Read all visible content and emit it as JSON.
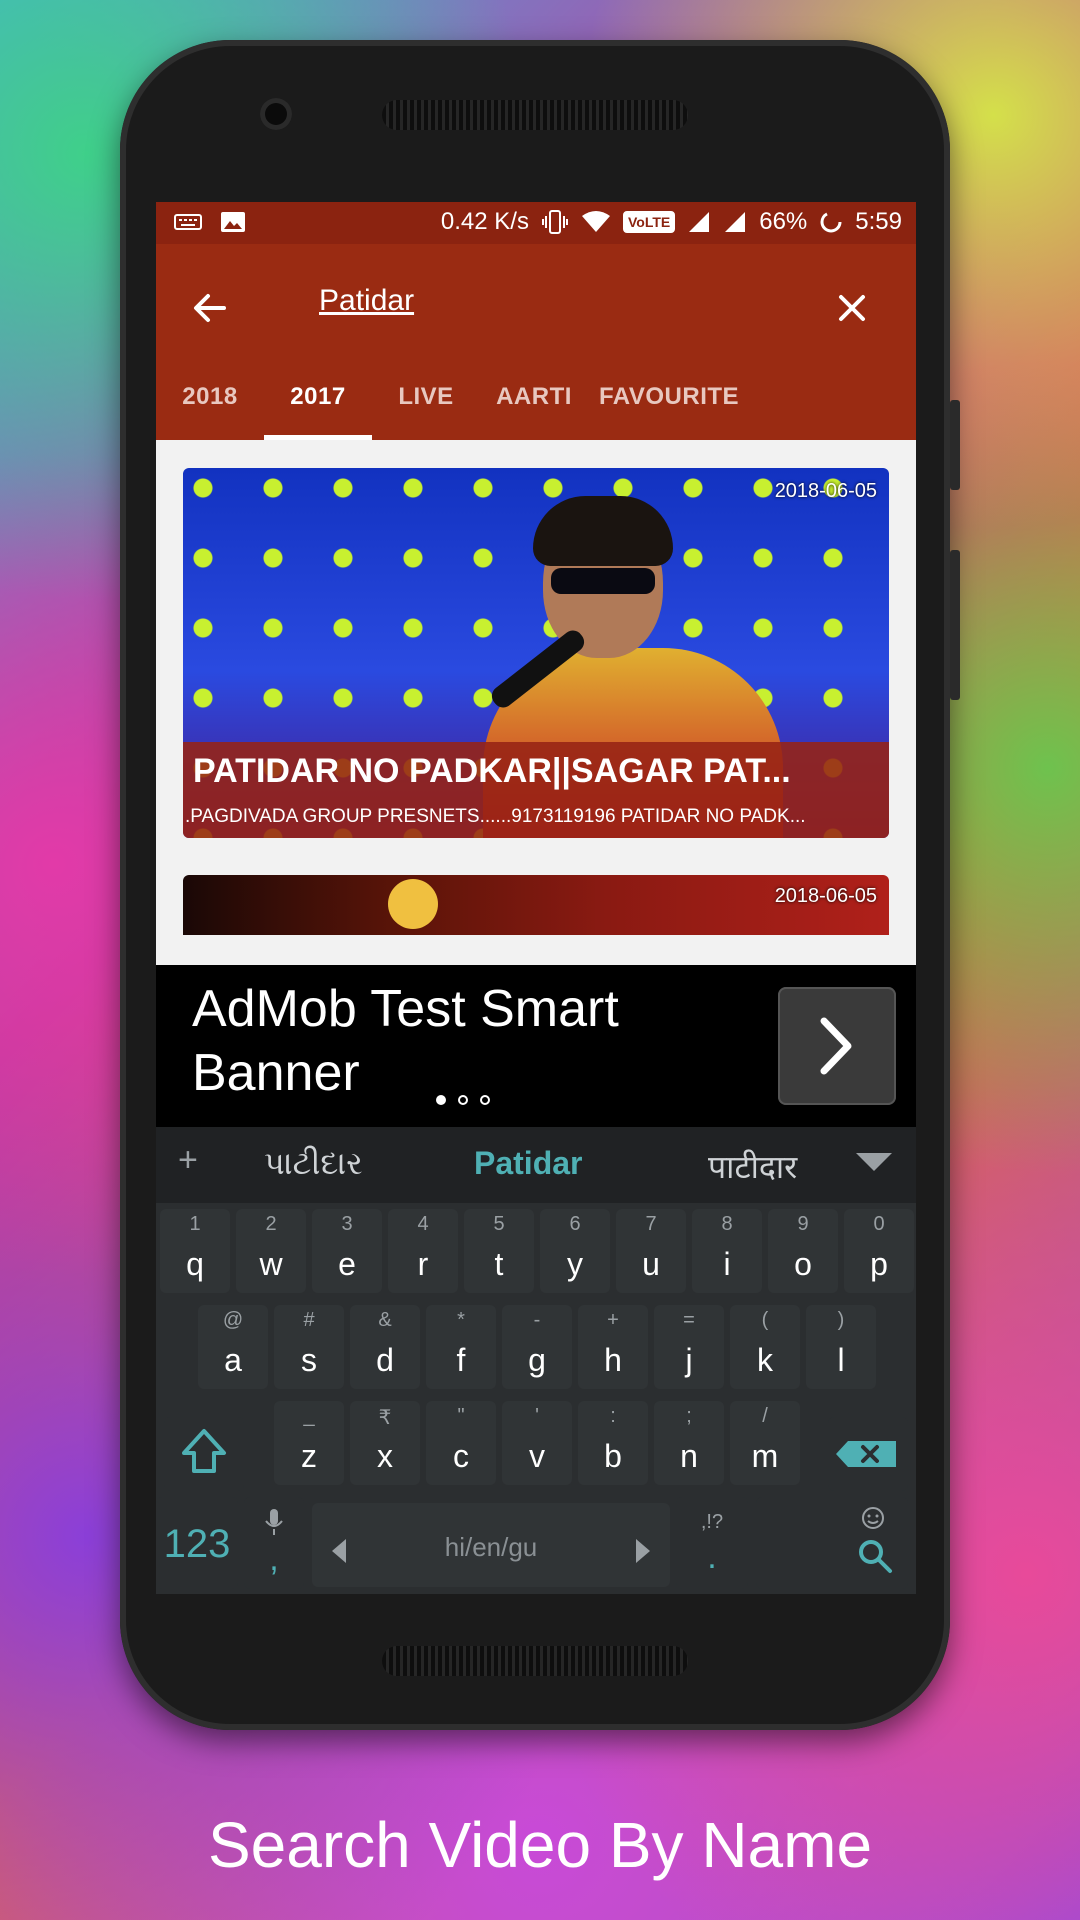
{
  "status_bar": {
    "speed": "0.42 K/s",
    "lte": "VoLTE",
    "battery": "66%",
    "time": "5:59"
  },
  "search": {
    "query": "Patidar"
  },
  "tabs": [
    {
      "label": "2018",
      "active": false
    },
    {
      "label": "2017",
      "active": true
    },
    {
      "label": "LIVE",
      "active": false
    },
    {
      "label": "AARTI",
      "active": false
    },
    {
      "label": "FAVOURITE",
      "active": false
    }
  ],
  "videos": [
    {
      "date": "2018-06-05",
      "title": "PATIDAR NO PADKAR||SAGAR PAT...",
      "description": ".PAGDIVADA GROUP PRESNETS......9173119196 PATIDAR NO PADK..."
    },
    {
      "date": "2018-06-05"
    }
  ],
  "ad": {
    "text": "AdMob Test Smart Banner",
    "arrow_icon": "chevron-right-icon"
  },
  "keyboard": {
    "suggestions": [
      "પાટીદાર",
      "Patidar",
      "पाटीदार"
    ],
    "plus": "+",
    "row1": [
      {
        "hint": "1",
        "key": "q"
      },
      {
        "hint": "2",
        "key": "w"
      },
      {
        "hint": "3",
        "key": "e"
      },
      {
        "hint": "4",
        "key": "r"
      },
      {
        "hint": "5",
        "key": "t"
      },
      {
        "hint": "6",
        "key": "y"
      },
      {
        "hint": "7",
        "key": "u"
      },
      {
        "hint": "8",
        "key": "i"
      },
      {
        "hint": "9",
        "key": "o"
      },
      {
        "hint": "0",
        "key": "p"
      }
    ],
    "row2": [
      {
        "hint": "@",
        "key": "a"
      },
      {
        "hint": "#",
        "key": "s"
      },
      {
        "hint": "&",
        "key": "d"
      },
      {
        "hint": "*",
        "key": "f"
      },
      {
        "hint": "-",
        "key": "g"
      },
      {
        "hint": "+",
        "key": "h"
      },
      {
        "hint": "=",
        "key": "j"
      },
      {
        "hint": "(",
        "key": "k"
      },
      {
        "hint": ")",
        "key": "l"
      }
    ],
    "row3": [
      {
        "hint": "_",
        "key": "z"
      },
      {
        "hint": "₹",
        "key": "x"
      },
      {
        "hint": "\"",
        "key": "c"
      },
      {
        "hint": "'",
        "key": "v"
      },
      {
        "hint": ":",
        "key": "b"
      },
      {
        "hint": ";",
        "key": "n"
      },
      {
        "hint": "/",
        "key": "m"
      }
    ],
    "numbers_label": "123",
    "comma": ",",
    "space_label": "hi/en/gu",
    "period_hint": ",!?",
    "period": "."
  },
  "caption": "Search Video By Name",
  "colors": {
    "status_bar": "#8b2310",
    "app_bar": "#9a2b12",
    "accent": "#4fb0b4",
    "keyboard": "#2b2e30"
  }
}
